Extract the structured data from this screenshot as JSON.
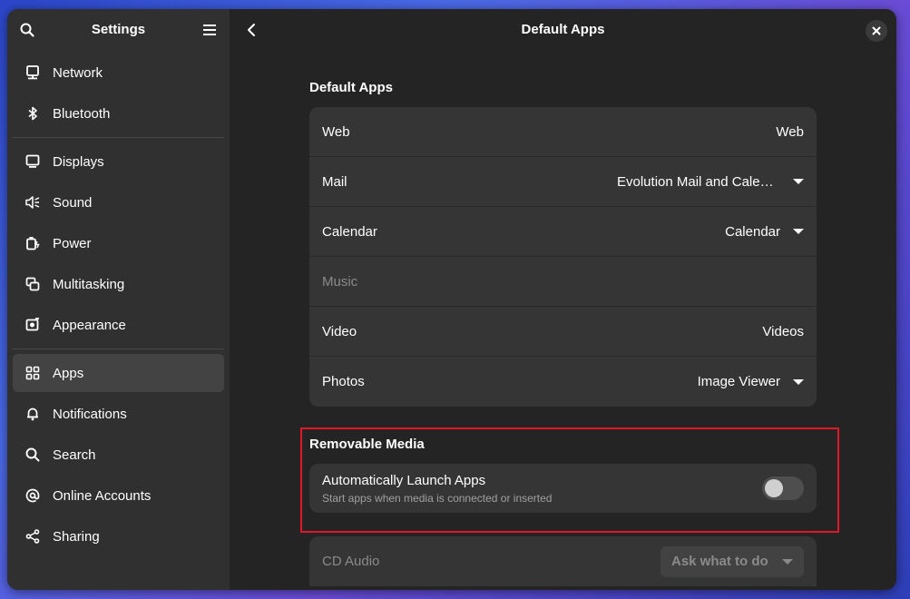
{
  "window": {
    "sidebar_title": "Settings",
    "page_title": "Default Apps"
  },
  "sidebar": {
    "groups": [
      [
        {
          "label": "Network",
          "icon": "network-icon"
        },
        {
          "label": "Bluetooth",
          "icon": "bluetooth-icon"
        }
      ],
      [
        {
          "label": "Displays",
          "icon": "display-icon"
        },
        {
          "label": "Sound",
          "icon": "sound-icon"
        },
        {
          "label": "Power",
          "icon": "power-icon"
        },
        {
          "label": "Multitasking",
          "icon": "multitasking-icon"
        },
        {
          "label": "Appearance",
          "icon": "appearance-icon"
        }
      ],
      [
        {
          "label": "Apps",
          "icon": "apps-icon",
          "selected": true
        },
        {
          "label": "Notifications",
          "icon": "bell-icon"
        },
        {
          "label": "Search",
          "icon": "search-icon"
        },
        {
          "label": "Online Accounts",
          "icon": "at-icon"
        },
        {
          "label": "Sharing",
          "icon": "share-icon"
        }
      ]
    ]
  },
  "default_apps": {
    "title": "Default Apps",
    "rows": [
      {
        "label": "Web",
        "value": "Web",
        "dropdown": false,
        "disabled": false
      },
      {
        "label": "Mail",
        "value": "Evolution Mail and Calendar",
        "dropdown": true,
        "disabled": false
      },
      {
        "label": "Calendar",
        "value": "Calendar",
        "dropdown": true,
        "disabled": false
      },
      {
        "label": "Music",
        "value": "",
        "dropdown": false,
        "disabled": true
      },
      {
        "label": "Video",
        "value": "Videos",
        "dropdown": false,
        "disabled": false
      },
      {
        "label": "Photos",
        "value": "Image Viewer",
        "dropdown": true,
        "disabled": false
      }
    ]
  },
  "removable_media": {
    "title": "Removable Media",
    "toggle_title": "Automatically Launch Apps",
    "toggle_subtitle": "Start apps when media is connected or inserted",
    "toggle_on": false
  },
  "cd_audio": {
    "label": "CD Audio",
    "value": "Ask what to do"
  },
  "colors": {
    "highlight": "#e0162b",
    "window_bg": "#242424",
    "sidebar_bg": "#303030",
    "card_bg": "#353535"
  }
}
